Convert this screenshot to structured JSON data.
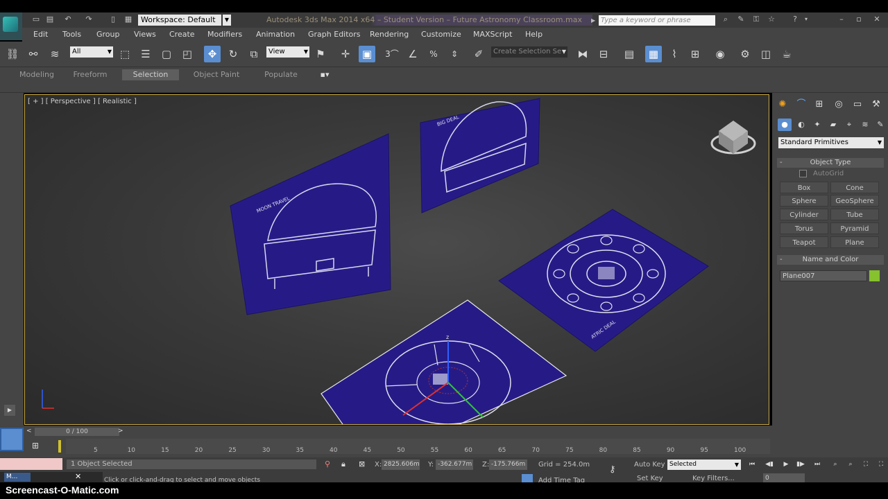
{
  "title_bar": {
    "workspace": "Workspace: Default",
    "app_title": "Autodesk 3ds Max 2014 x64 – Student Version – Future Astronomy Classroom.max",
    "search_placeholder": "Type a keyword or phrase"
  },
  "menu": [
    "Edit",
    "Tools",
    "Group",
    "Views",
    "Create",
    "Modifiers",
    "Animation",
    "Graph Editors",
    "Rendering",
    "Customize",
    "MAXScript",
    "Help"
  ],
  "toolbar": {
    "filter": "All",
    "refcoord": "View",
    "named_selection": "Create Selection Se",
    "active_color": "#5a8ed0"
  },
  "ribbon": {
    "tabs": [
      "Modeling",
      "Freeform",
      "Selection",
      "Object Paint",
      "Populate"
    ],
    "selected": "Selection"
  },
  "viewport": {
    "label": "[ + ] [ Perspective ] [ Realistic ]",
    "border_color": "#cfae4a",
    "plane_color": "#2a1f8a"
  },
  "command_panel": {
    "category": "Standard Primitives",
    "object_type_header": "Object Type",
    "autogrid": "AutoGrid",
    "buttons": [
      "Box",
      "Cone",
      "Sphere",
      "GeoSphere",
      "Cylinder",
      "Tube",
      "Torus",
      "Pyramid",
      "Teapot",
      "Plane"
    ],
    "name_color_header": "Name and Color",
    "object_name": "Plane007",
    "object_color": "#86c12e"
  },
  "timeline": {
    "frame": "0 / 100",
    "ticks": [
      "5",
      "10",
      "15",
      "20",
      "25",
      "30",
      "35",
      "40",
      "45",
      "50",
      "55",
      "60",
      "65",
      "70",
      "75",
      "80",
      "85",
      "90",
      "95",
      "100"
    ]
  },
  "status": {
    "selection": "1 Object Selected",
    "prompt": "Click or click-and-drag to select and move objects",
    "x_label": "X:",
    "x": "2825.606m",
    "y_label": "Y:",
    "y": "-362.677m",
    "z_label": "Z:",
    "z": "-175.766m",
    "grid": "Grid = 254.0m",
    "auto_key": "Auto Key",
    "set_key": "Set Key",
    "key_mode": "Selected",
    "key_filters": "Key Filters...",
    "add_time_tag": "Add Time Tag",
    "current_frame": "0"
  },
  "taskbar": {
    "item": "M..."
  },
  "watermark": "Screencast-O-Matic.com"
}
